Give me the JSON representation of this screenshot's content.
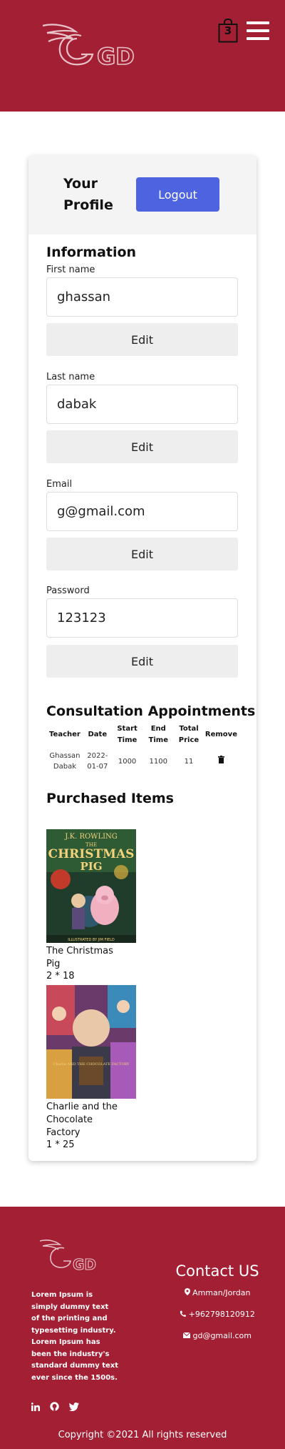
{
  "header": {
    "brand_letters": "GD",
    "cart_count": "3"
  },
  "profile": {
    "title": "Your Profile",
    "logout_label": "Logout",
    "information_title": "Information",
    "fields": [
      {
        "label": "First name",
        "value": "ghassan",
        "edit_label": "Edit"
      },
      {
        "label": "Last name",
        "value": "dabak",
        "edit_label": "Edit"
      },
      {
        "label": "Email",
        "value": "g@gmail.com",
        "edit_label": "Edit"
      },
      {
        "label": "Password",
        "value": "123123",
        "edit_label": "Edit"
      }
    ]
  },
  "appointments": {
    "title": "Consultation Appointments",
    "columns": [
      "Teacher",
      "Date",
      "Start Time",
      "End Time",
      "Total Price",
      "Remove"
    ],
    "rows": [
      {
        "teacher": "Ghassan Dabak",
        "date": "2022-01-07",
        "start": "1000",
        "end": "1100",
        "price": "11",
        "remove_icon": "trash-icon"
      }
    ]
  },
  "purchased": {
    "title": "Purchased Items",
    "items": [
      {
        "name": "The Christmas Pig",
        "qty": "2 * 18",
        "cover_author": "J.K. ROWLING",
        "cover_title_1": "THE",
        "cover_title_2": "CHRISTMAS",
        "cover_title_3": "PIG",
        "cover_credit": "ILLUSTRATED BY JIM FIELD"
      },
      {
        "name": "Charlie and the Chocolate Factory",
        "qty": "1 * 25",
        "cover_text": "Charlie AND THE CHOCOLATE FACTORY"
      }
    ]
  },
  "footer": {
    "about": "Lorem Ipsum is simply dummy text of the printing and typesetting industry. Lorem Ipsum has been the industry's standard dummy text ever since the 1500s.",
    "contact_title": "Contact US",
    "location": "Amman/Jordan",
    "phone": "+962798120912",
    "email": "gd@gmail.com",
    "social_icons": [
      "linkedin-icon",
      "github-icon",
      "twitter-icon"
    ],
    "copyright": "Copyright ©2021 All rights reserved"
  },
  "colors": {
    "brand": "#a31f34",
    "button": "#4e63e0"
  }
}
